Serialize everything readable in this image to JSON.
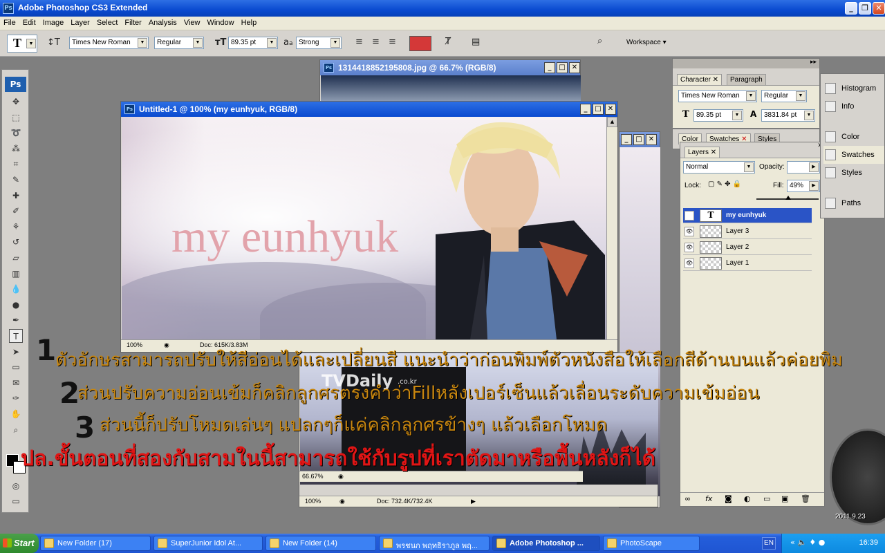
{
  "app": {
    "title": "Adobe Photoshop CS3 Extended",
    "icon": "Ps",
    "window_buttons": [
      "_",
      "❐",
      "✕"
    ]
  },
  "menu": [
    "File",
    "Edit",
    "Image",
    "Layer",
    "Select",
    "Filter",
    "Analysis",
    "View",
    "Window",
    "Help"
  ],
  "options": {
    "tool_glyph": "T",
    "font_family": "Times New Roman",
    "font_style": "Regular",
    "font_size": "89.35 pt",
    "aa_label": "a",
    "antialias": "Strong",
    "text_color": "#d43838",
    "workspace_label": "Workspace"
  },
  "toolbox": {
    "logo": "Ps",
    "tools": [
      {
        "name": "move-tool-icon",
        "glyph": "✥"
      },
      {
        "name": "marquee-tool-icon",
        "glyph": "⬚"
      },
      {
        "name": "lasso-tool-icon",
        "glyph": "➰"
      },
      {
        "name": "magic-wand-tool-icon",
        "glyph": "⁂"
      },
      {
        "name": "crop-tool-icon",
        "glyph": "⌗"
      },
      {
        "name": "slice-tool-icon",
        "glyph": "✎"
      },
      {
        "name": "healing-brush-icon",
        "glyph": "✚"
      },
      {
        "name": "brush-tool-icon",
        "glyph": "✐"
      },
      {
        "name": "clone-stamp-icon",
        "glyph": "⚘"
      },
      {
        "name": "history-brush-icon",
        "glyph": "↺"
      },
      {
        "name": "eraser-tool-icon",
        "glyph": "▱"
      },
      {
        "name": "gradient-tool-icon",
        "glyph": "▥"
      },
      {
        "name": "blur-tool-icon",
        "glyph": "💧"
      },
      {
        "name": "dodge-tool-icon",
        "glyph": "●"
      },
      {
        "name": "pen-tool-icon",
        "glyph": "✒"
      },
      {
        "name": "type-tool-icon",
        "glyph": "T"
      },
      {
        "name": "path-selection-icon",
        "glyph": "➤"
      },
      {
        "name": "shape-tool-icon",
        "glyph": "▭"
      },
      {
        "name": "notes-tool-icon",
        "glyph": "✉"
      },
      {
        "name": "eyedropper-tool-icon",
        "glyph": "✑"
      },
      {
        "name": "hand-tool-icon",
        "glyph": "✋"
      },
      {
        "name": "zoom-tool-icon",
        "glyph": "⌕"
      }
    ]
  },
  "back_window": {
    "title": "1314418852195808.jpg @ 66.7% (RGB/8)"
  },
  "main_window": {
    "title": "Untitled-1 @ 100% (my eunhyuk, RGB/8)",
    "canvas_text": "my eunhyuk",
    "zoom": "100%",
    "doc": "Doc: 615K/3.83M"
  },
  "bottom_window": {
    "zoom": "66.67%",
    "watermark": "TVDaily",
    "watermark_sub": ".co.kr"
  },
  "outer_window": {
    "zoom": "100%",
    "doc": "Doc: 732.4K/732.4K"
  },
  "character_panel": {
    "tabs": [
      "Character",
      "Paragraph"
    ],
    "font_family": "Times New Roman",
    "font_style": "Regular",
    "font_size": "89.35 pt",
    "leading": "3831.84 pt"
  },
  "swatch_panel": {
    "tabs": [
      "Color",
      "Swatches",
      "Styles"
    ]
  },
  "layers_panel": {
    "tab": "Layers",
    "blend_mode": "Normal",
    "opacity_label": "Opacity:",
    "lock_label": "Lock:",
    "fill_label": "Fill:",
    "fill_value": "49%",
    "layers": [
      {
        "name": "my eunhyuk",
        "type": "text",
        "selected": true
      },
      {
        "name": "Layer 3",
        "type": "image",
        "selected": false
      },
      {
        "name": "Layer 2",
        "type": "image",
        "selected": false
      },
      {
        "name": "Layer 1",
        "type": "image",
        "selected": false
      }
    ]
  },
  "side_panels": [
    {
      "label": "Histogram",
      "icon": "histogram-icon"
    },
    {
      "label": "Info",
      "icon": "info-icon"
    },
    {
      "label": "Color",
      "icon": "color-icon"
    },
    {
      "label": "Swatches",
      "icon": "swatches-icon"
    },
    {
      "label": "Styles",
      "icon": "styles-icon"
    },
    {
      "label": "Paths",
      "icon": "paths-icon"
    }
  ],
  "annotations": {
    "numbers": [
      "1",
      "2",
      "3"
    ],
    "line1": "ตัวอักษรสามารถปรับให้สีอ่อนได้และเปลี่ยนสี แนะนำว่าก่อนพิมพ์ตัวหนังสือให้เลือกสีด้านบนแล้วค่อยพิม",
    "line2": "ส่วนปรับความอ่อนเข้มก็คลิกลูกศรตรงคำว่าFillหลังเปอร์เซ็นแล้วเลื่อนระดับความเข้มอ่อน",
    "line3": "ส่วนนี้ก็ปรับโหมดเล่นๆ แปลกๆก็แค่คลิกลูกศรข้างๆ แล้วเลือกโหมด",
    "line4": "ปล.ขั้นตอนที่สองกับสามในนี้สามารถใช้กับรูปที่เราตัดมาหรือพื้นหลังก็ได้",
    "color_orange": "#c8860f",
    "color_red": "#e01515"
  },
  "taskbar": {
    "start": "Start",
    "buttons": [
      {
        "label": "New Folder (17)",
        "active": false
      },
      {
        "label": "SuperJunior Idol At...",
        "active": false
      },
      {
        "label": "New Folder (14)",
        "active": false
      },
      {
        "label": "พรชนก พฤทธิราภูล พฤ...",
        "active": false
      },
      {
        "label": "Adobe Photoshop ...",
        "active": true
      },
      {
        "label": "PhotoScape",
        "active": false
      }
    ],
    "lang": "EN",
    "clock": "16:39"
  },
  "desktop": {
    "date": "2011.9.23"
  }
}
